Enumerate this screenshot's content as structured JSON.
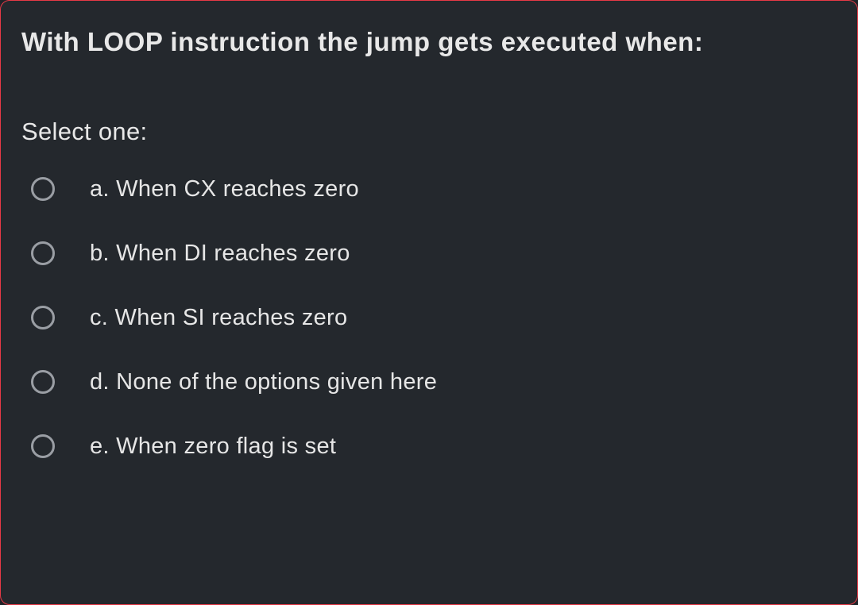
{
  "question": "With LOOP instruction the jump gets executed when:",
  "prompt": "Select one:",
  "options": [
    {
      "letter": "a.",
      "text": "When CX reaches zero"
    },
    {
      "letter": "b.",
      "text": "When DI reaches zero"
    },
    {
      "letter": "c.",
      "text": "When SI reaches zero"
    },
    {
      "letter": "d.",
      "text": "None of the options given here"
    },
    {
      "letter": "e.",
      "text": "When zero flag is set"
    }
  ]
}
